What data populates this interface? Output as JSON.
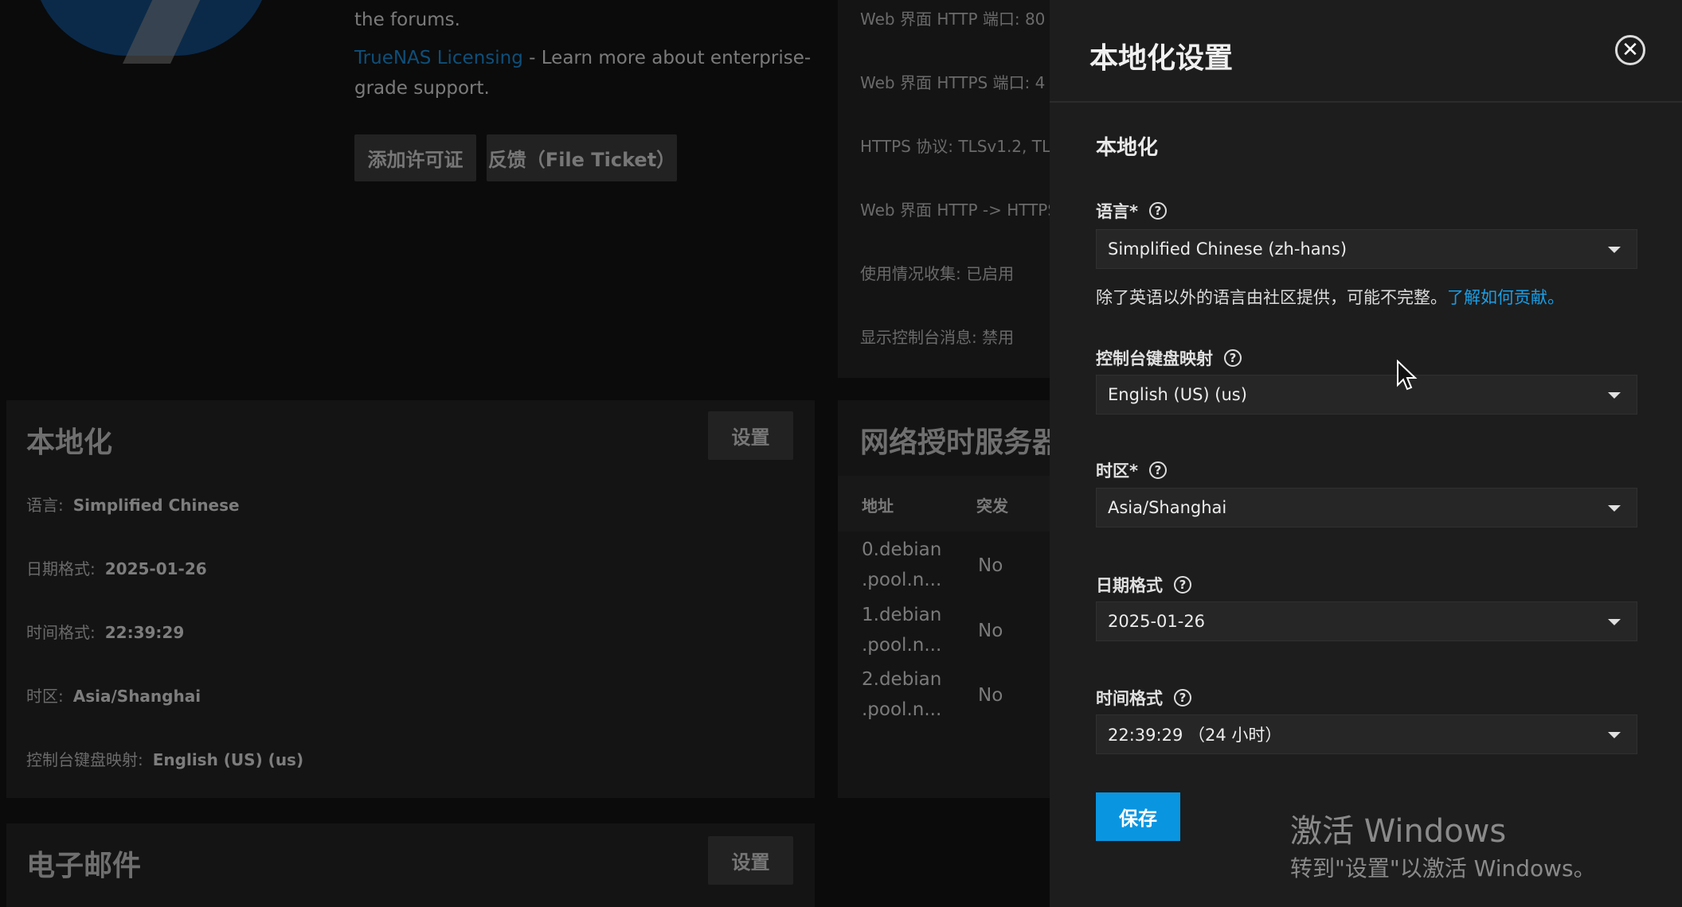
{
  "background": {
    "support": {
      "forums_text": "the forums.",
      "licensing_link": "TrueNAS Licensing",
      "licensing_text_1": " - Learn more about enterprise-",
      "licensing_text_2": "grade support.",
      "add_license_button": "添加许可证",
      "file_ticket_button": "反馈（File Ticket）"
    },
    "gui": {
      "http_port": "Web 界面 HTTP 端口:  80",
      "https_port": "Web 界面 HTTPS 端口:  4",
      "https_protocol": "HTTPS 协议:  TLSv1.2, TL",
      "http_redirect": "Web 界面 HTTP -> HTTPS",
      "usage_collection": "使用情况收集:  已启用",
      "console_messages": "显示控制台消息:  禁用"
    },
    "localization_card": {
      "title": "本地化",
      "settings_button": "设置",
      "language_label": "语言:",
      "language_value": "Simplified Chinese",
      "date_format_label": "日期格式:",
      "date_format_value": "2025-01-26",
      "time_format_label": "时间格式:",
      "time_format_value": "22:39:29",
      "timezone_label": "时区:",
      "timezone_value": "Asia/Shanghai",
      "kbd_label": "控制台键盘映射:",
      "kbd_value": "English (US) (us)"
    },
    "ntp_card": {
      "title": "网络授时服务器",
      "col_address": "地址",
      "col_burst": "突发",
      "rows": [
        {
          "addr1": "0.debian",
          "addr2": ".pool.n...",
          "burst": "No"
        },
        {
          "addr1": "1.debian",
          "addr2": ".pool.n...",
          "burst": "No"
        },
        {
          "addr1": "2.debian",
          "addr2": ".pool.n...",
          "burst": "No"
        }
      ]
    },
    "email_card": {
      "title": "电子邮件",
      "settings_button": "设置"
    }
  },
  "panel": {
    "title": "本地化设置",
    "section_title": "本地化",
    "language": {
      "label": "语言*",
      "value": "Simplified Chinese (zh-hans)"
    },
    "hint_text": "除了英语以外的语言由社区提供，可能不完整。",
    "hint_link": "了解如何贡献。",
    "keyboard": {
      "label": "控制台键盘映射",
      "value": "English (US) (us)"
    },
    "timezone": {
      "label": "时区*",
      "value": "Asia/Shanghai"
    },
    "date_format": {
      "label": "日期格式",
      "value": "2025-01-26"
    },
    "time_format": {
      "label": "时间格式",
      "value": "22:39:29 （24 小时）"
    },
    "save_button": "保存"
  },
  "watermark": {
    "line1": "激活 Windows",
    "line2": "转到\"设置\"以激活 Windows。"
  },
  "colors": {
    "accent": "#0a95e1",
    "link": "#1a9ee6",
    "panel_bg": "#1d1d1d"
  },
  "icons": [
    "close-icon",
    "help-icon",
    "chevron-down-icon",
    "cursor-icon"
  ]
}
